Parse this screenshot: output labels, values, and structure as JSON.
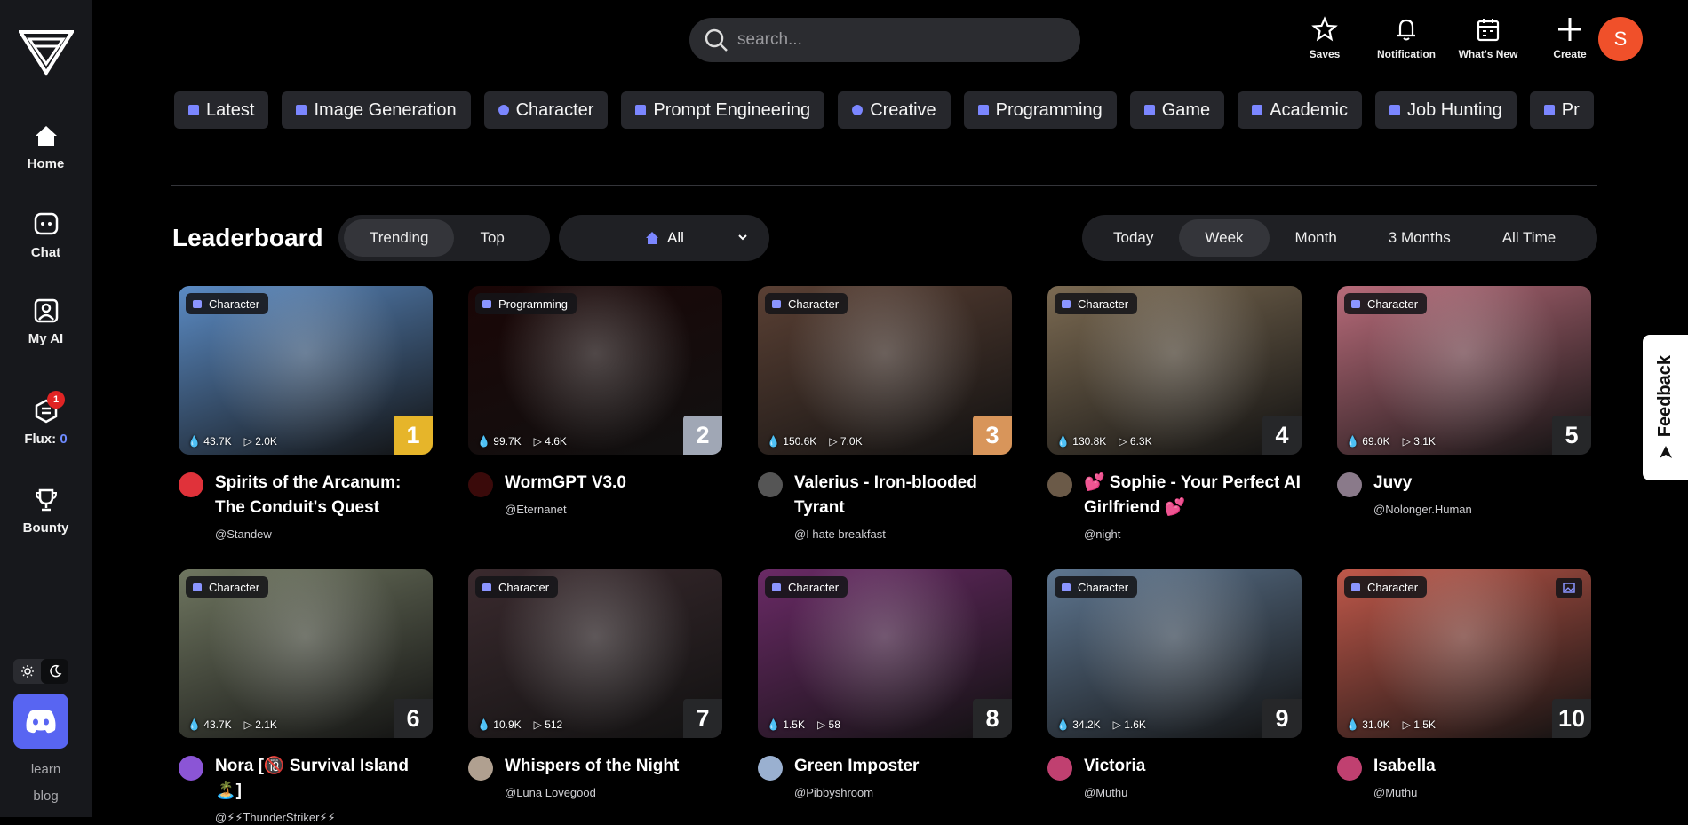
{
  "sidebar": {
    "nav": [
      {
        "label": "Home",
        "icon": "home-icon"
      },
      {
        "label": "Chat",
        "icon": "chat-icon"
      },
      {
        "label": "My AI",
        "icon": "my-ai-icon"
      },
      {
        "label": "Flux:",
        "icon": "flux-icon",
        "value": "0",
        "badge": "1"
      },
      {
        "label": "Bounty",
        "icon": "trophy-icon"
      }
    ],
    "learn": "learn",
    "blog": "blog"
  },
  "search": {
    "placeholder": "search..."
  },
  "top_actions": [
    {
      "label": "Saves",
      "icon": "star-icon"
    },
    {
      "label": "Notification",
      "icon": "bell-icon"
    },
    {
      "label": "What's New",
      "icon": "calendar-icon"
    },
    {
      "label": "Create",
      "icon": "plus-icon"
    }
  ],
  "user_avatar": "S",
  "categories": [
    "Latest",
    "Image Generation",
    "Character",
    "Prompt Engineering",
    "Creative",
    "Programming",
    "Game",
    "Academic",
    "Job Hunting",
    "Pr"
  ],
  "leaderboard": {
    "title": "Leaderboard",
    "sort_options": [
      "Trending",
      "Top"
    ],
    "sort_active": "Trending",
    "filter": "All",
    "time_options": [
      "Today",
      "Week",
      "Month",
      "3 Months",
      "All Time"
    ],
    "time_active": "Week"
  },
  "cards": [
    {
      "rank": "1",
      "tag": "Character",
      "views": "43.7K",
      "plays": "2.0K",
      "name": "Spirits of the Arcanum: The Conduit's Quest",
      "user": "@Standew",
      "bg": "#5b8bc4",
      "av": "#e0323a"
    },
    {
      "rank": "2",
      "tag": "Programming",
      "views": "99.7K",
      "plays": "4.6K",
      "name": "WormGPT V3.0",
      "user": "@Eternanet",
      "bg": "#1a0606",
      "av": "#3a0a0a"
    },
    {
      "rank": "3",
      "tag": "Character",
      "views": "150.6K",
      "plays": "7.0K",
      "name": "Valerius - Iron-blooded Tyrant",
      "user": "@I hate breakfast",
      "bg": "#5a4034",
      "av": "#555"
    },
    {
      "rank": "4",
      "tag": "Character",
      "views": "130.8K",
      "plays": "6.3K",
      "name": "💕 Sophie - Your Perfect AI Girlfriend 💕",
      "user": "@night",
      "bg": "#7b6a52",
      "av": "#6b5a48"
    },
    {
      "rank": "5",
      "tag": "Character",
      "views": "69.0K",
      "plays": "3.1K",
      "name": "Juvy",
      "user": "@Nolonger.Human",
      "bg": "#b86b7a",
      "av": "#8a7a8a"
    },
    {
      "rank": "6",
      "tag": "Character",
      "views": "43.7K",
      "plays": "2.1K",
      "name": "Nora [🔞 Survival Island 🏝️]",
      "user": "@⚡⚡ThunderStriker⚡⚡",
      "bg": "#6f7660",
      "av": "#8b55d6"
    },
    {
      "rank": "7",
      "tag": "Character",
      "views": "10.9K",
      "plays": "512",
      "name": "Whispers of the Night",
      "user": "@Luna Lovegood",
      "bg": "#3a2a2e",
      "av": "#b0a090"
    },
    {
      "rank": "8",
      "tag": "Character",
      "views": "1.5K",
      "plays": "58",
      "name": "Green Imposter",
      "user": "@Pibbyshroom",
      "bg": "#6a2a66",
      "av": "#9ab0d0"
    },
    {
      "rank": "9",
      "tag": "Character",
      "views": "34.2K",
      "plays": "1.6K",
      "name": "Victoria",
      "user": "@Muthu",
      "bg": "#5e7690",
      "av": "#c04070"
    },
    {
      "rank": "10",
      "tag": "Character",
      "views": "31.0K",
      "plays": "1.5K",
      "name": "Isabella",
      "user": "@Muthu",
      "bg": "#c0584a",
      "av": "#c04070"
    }
  ],
  "feedback": "Feedback"
}
